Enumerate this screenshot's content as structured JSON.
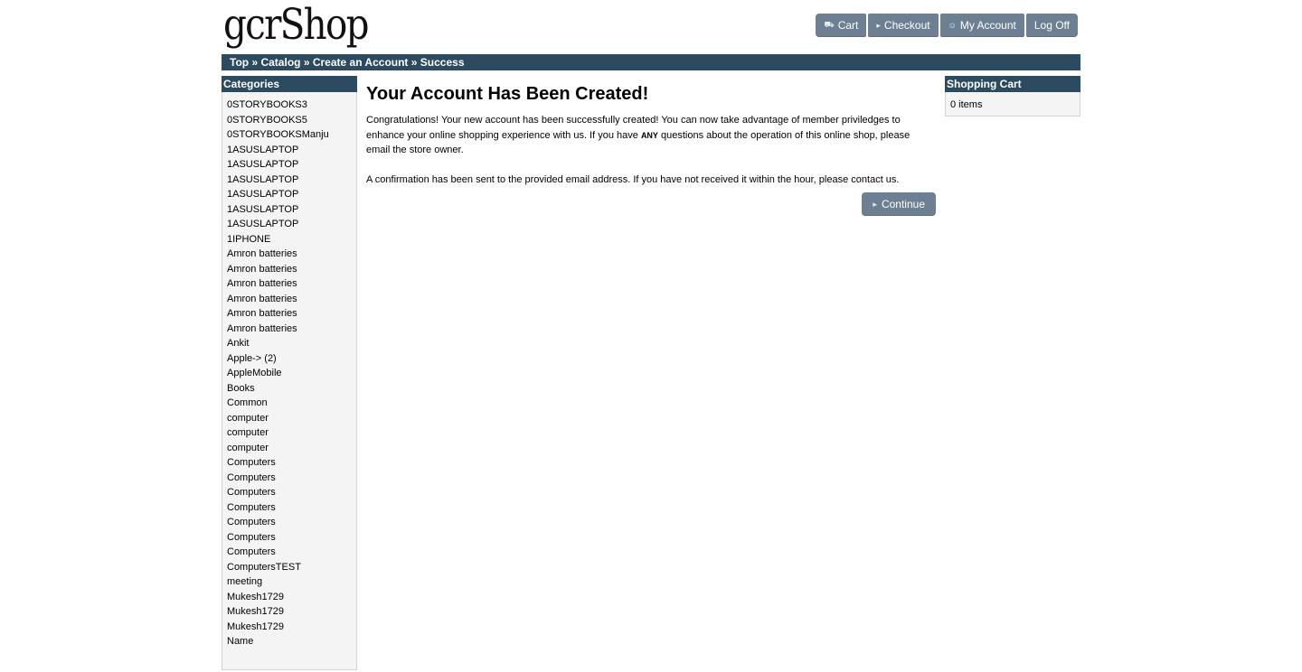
{
  "logo": "gcrShop",
  "header_nav": [
    {
      "label": "Cart",
      "icon": "cart-icon",
      "glyph": "⛟"
    },
    {
      "label": "Checkout",
      "icon": "triangle-right-icon",
      "glyph": "▸"
    },
    {
      "label": "My Account",
      "icon": "person-icon",
      "glyph": "☺"
    },
    {
      "label": "Log Off",
      "icon": "",
      "glyph": ""
    }
  ],
  "breadcrumb": {
    "items": [
      "Top",
      "Catalog",
      "Create an Account",
      "Success"
    ],
    "separator": "»"
  },
  "categories": {
    "title": "Categories",
    "items": [
      "0STORYBOOKS3",
      "0STORYBOOKS5",
      "0STORYBOOKSManju",
      "1ASUSLAPTOP",
      "1ASUSLAPTOP",
      "1ASUSLAPTOP",
      "1ASUSLAPTOP",
      "1ASUSLAPTOP",
      "1ASUSLAPTOP",
      "1IPHONE",
      "Amron batteries",
      "Amron batteries",
      "Amron batteries",
      "Amron batteries",
      "Amron batteries",
      "Amron batteries",
      "Ankit",
      "Apple-> (2)",
      "AppleMobile",
      "Books",
      "Common",
      "computer",
      "computer",
      "computer",
      "Computers",
      "Computers",
      "Computers",
      "Computers",
      "Computers",
      "Computers",
      "Computers",
      "ComputersTEST",
      "meeting",
      "Mukesh1729",
      "Mukesh1729",
      "Mukesh1729",
      "Name"
    ]
  },
  "main": {
    "title": "Your Account Has Been Created!",
    "p1_before": "Congratulations! Your new account has been successfully created! You can now take advantage of member priviledges to enhance your online shopping experience with us. If you have ",
    "p1_any": "ANY",
    "p1_after": " questions about the operation of this online shop, please ",
    "p1_link": "email the store owner",
    "p1_end": ".",
    "p2_before": "A confirmation has been sent to the provided email address. If you have not received it within the hour, please ",
    "p2_link": "contact us",
    "p2_end": ".",
    "continue_label": "Continue",
    "continue_icon": "triangle-right-icon"
  },
  "shopping_cart": {
    "title": "Shopping Cart",
    "status": "0 items"
  },
  "colors": {
    "header_bar": "#2c4a60",
    "button": "#6d8093",
    "sidebar_bg": "#f4f4f4"
  }
}
